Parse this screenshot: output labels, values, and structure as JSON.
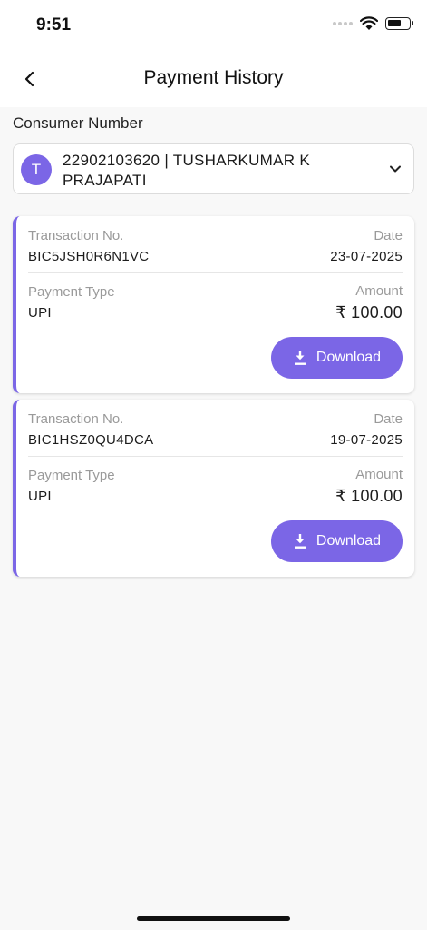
{
  "status_bar": {
    "time": "9:51"
  },
  "header": {
    "title": "Payment History",
    "back_icon": "chevron-left-icon"
  },
  "consumer": {
    "label": "Consumer Number",
    "avatar_letter": "T",
    "selected_value": "22902103620 | TUSHARKUMAR K PRAJAPATI",
    "dropdown_icon": "chevron-down-icon"
  },
  "labels": {
    "transaction_no": "Transaction No.",
    "date": "Date",
    "payment_type": "Payment Type",
    "amount": "Amount",
    "download": "Download"
  },
  "transactions": [
    {
      "transaction_no": "BIC5JSH0R6N1VC",
      "date": "23-07-2025",
      "payment_type": "UPI",
      "amount": "₹ 100.00"
    },
    {
      "transaction_no": "BIC1HSZ0QU4DCA",
      "date": "19-07-2025",
      "payment_type": "UPI",
      "amount": "₹ 100.00"
    }
  ],
  "colors": {
    "accent": "#7b66e6",
    "background": "#f8f8f8",
    "card": "#ffffff",
    "label": "#9a9a9a"
  }
}
